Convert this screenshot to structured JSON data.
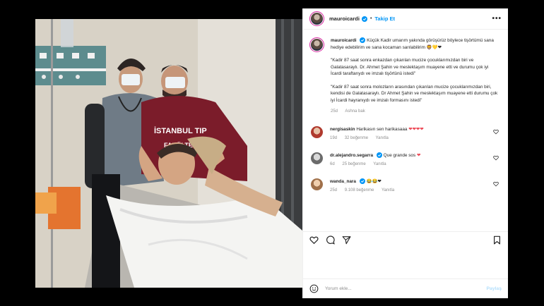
{
  "post": {
    "username": "mauroicardi",
    "follow_label": "Takip Et",
    "more_label": "•••",
    "separator": "•",
    "caption": {
      "username": "mauroicardi",
      "line1": "Küçük Kadir umarım yakında görüşürüz böylece tişörtümü sana hediye edebilirim ve sana kocaman sarılabilirim 🦁💛❤",
      "quote1": "\"Kadir 87 saat sonra enkazdan çıkarılan mucize çocuklarımızdan biri ve Galatasaraylı. Dr. Ahmet Şahin ve meslektaşım muayene etti ve durumu çok iyi İcardi taraftarıydı ve imzalı tişörtünü istedi\"",
      "quote2": "\"Kadir 87 saat sonra molozların arasından çıkarılan mucize çocuklarımızdan biri, kendisi de Galatasaraylı. Dr Ahmet Şahin ve meslektaşım muayene etti durumu çok iyi İcardi hayranıydı ve imzalı formasını istedi\"",
      "time": "25d",
      "translate": "Ashna bak"
    },
    "comments": [
      {
        "username": "nergisaskin",
        "verified": false,
        "text": "Harikasın sen harikasaaa",
        "emoji": "❤❤❤❤",
        "time": "19d",
        "likes": "32 beğenme",
        "reply": "Yanıtla",
        "avatar_color": "#c0392b"
      },
      {
        "username": "dr.alejandro.segarra",
        "verified": true,
        "text": "Que grande sos",
        "emoji": "❤",
        "time": "6d",
        "likes": "25 beğenme",
        "reply": "Yanıtla",
        "avatar_color": "#8e8e8e"
      },
      {
        "username": "wanda_nara",
        "verified": true,
        "text": "😂😂❤",
        "emoji": "",
        "time": "25d",
        "likes": "9.108 beğenme",
        "reply": "Yanıtla",
        "avatar_color": "#d4a373"
      }
    ],
    "add_comment": {
      "placeholder": "Yorum ekle...",
      "post_label": "Paylaş"
    }
  },
  "colors": {
    "accent_blue": "#0095f6",
    "heart_red": "#ed4956",
    "muted": "#8e8e8e",
    "post_disabled": "#b2dffc"
  },
  "icons": [
    "verified-badge-icon",
    "more-options-icon",
    "heart-icon",
    "comment-icon",
    "share-icon",
    "bookmark-icon",
    "emoji-icon",
    "next-arrow-icon"
  ]
}
